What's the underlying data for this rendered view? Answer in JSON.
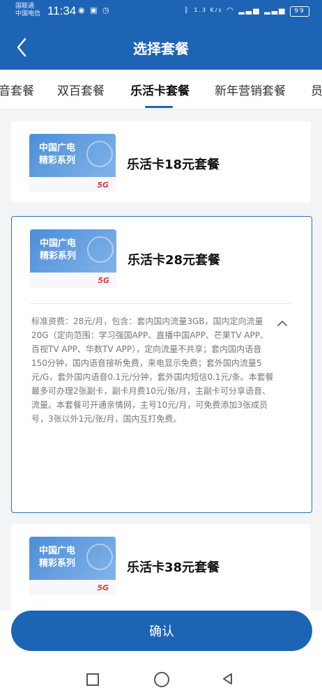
{
  "status_bar": {
    "carrier_line1": "国联通",
    "carrier_line2": "中国电信",
    "time": "11:34",
    "speed": "1.3\nK/s",
    "battery": "99"
  },
  "header": {
    "title": "选择套餐",
    "back_icon": "chevron-left-icon"
  },
  "tabs": [
    {
      "label": "音套餐"
    },
    {
      "label": "双百套餐"
    },
    {
      "label": "乐活卡套餐"
    },
    {
      "label": "新年营销套餐"
    },
    {
      "label": "员"
    }
  ],
  "cards": [
    {
      "brand": "中国广电\n精彩系列",
      "network": "5G",
      "plan_name": "乐活卡18元套餐"
    },
    {
      "brand": "中国广电\n精彩系列",
      "network": "5G",
      "plan_name": "乐活卡28元套餐",
      "description": "标准资费：28元/月，包含：套内国内流量3GB，国内定向流量20G（定向范围：学习强国APP、直播中国APP、芒果TV APP、百视TV APP、华数TV APP），定向流量不共享；套内国内语音150分钟，国内语音接听免费，来电显示免费；套外国内流量5元/G，套外国内语音0.1元/分钟，套外国内短信0.1元/条。本套餐最多可办理2张副卡，副卡月费10元/张/月，主副卡可分享语音、流量。本套餐可开通亲情网，主号10元/月，可免费添加3张成员号，3张以外1元/张/月，国内互打免费。"
    },
    {
      "brand": "中国广电\n精彩系列",
      "network": "5G",
      "plan_name": "乐活卡38元套餐"
    }
  ],
  "footer": {
    "confirm_label": "确认"
  },
  "colors": {
    "primary": "#1d64b4"
  }
}
